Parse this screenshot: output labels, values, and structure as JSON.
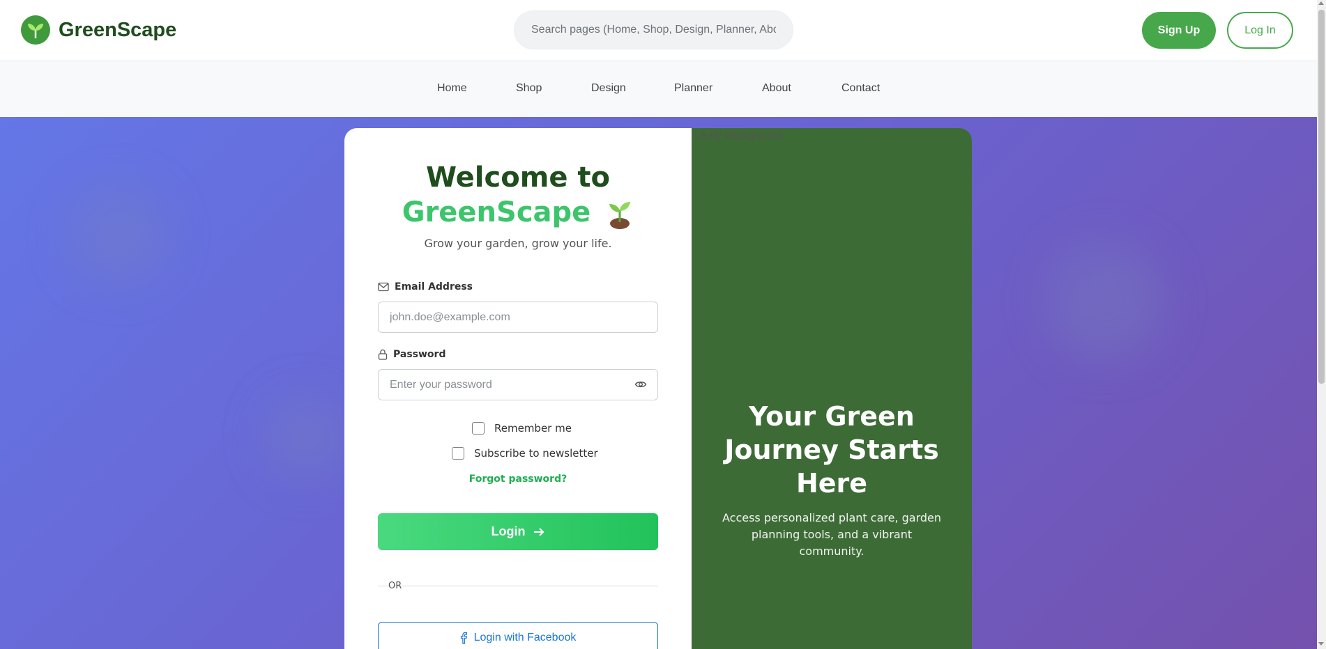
{
  "header": {
    "brand": "GreenScape",
    "search_placeholder": "Search pages (Home, Shop, Design, Planner, About, Contact)",
    "signup_label": "Sign Up",
    "login_label": "Log In"
  },
  "nav": {
    "items": [
      {
        "label": "Home"
      },
      {
        "label": "Shop"
      },
      {
        "label": "Design"
      },
      {
        "label": "Planner"
      },
      {
        "label": "About"
      },
      {
        "label": "Contact"
      }
    ]
  },
  "login_card": {
    "title_line1": "Welcome to",
    "title_line2": "GreenScape",
    "emoji_icon": "seedling-icon",
    "tagline": "Grow your garden, grow your life.",
    "email_label": "Email Address",
    "email_placeholder": "john.doe@example.com",
    "email_value": "",
    "password_label": "Password",
    "password_placeholder": "Enter your password",
    "password_value": "",
    "remember_label": "Remember me",
    "remember_checked": false,
    "newsletter_label": "Subscribe to newsletter",
    "newsletter_checked": false,
    "forgot_label": "Forgot password?",
    "submit_label": "Login",
    "divider_label": "OR",
    "facebook_label": "Login with Facebook"
  },
  "side_panel": {
    "image_alt": "Leafy background",
    "heading": "Your Green Journey Starts Here",
    "subtext": "Access personalized plant care, garden planning tools, and a vibrant community."
  },
  "colors": {
    "brand_green": "#46a84a",
    "dark_green": "#1f4d1d",
    "accent_green": "#3cc56b",
    "facebook_blue": "#1976d2",
    "panel_green": "#3d6b36",
    "hero_gradient_start": "#6477e6",
    "hero_gradient_end": "#7451ad"
  }
}
